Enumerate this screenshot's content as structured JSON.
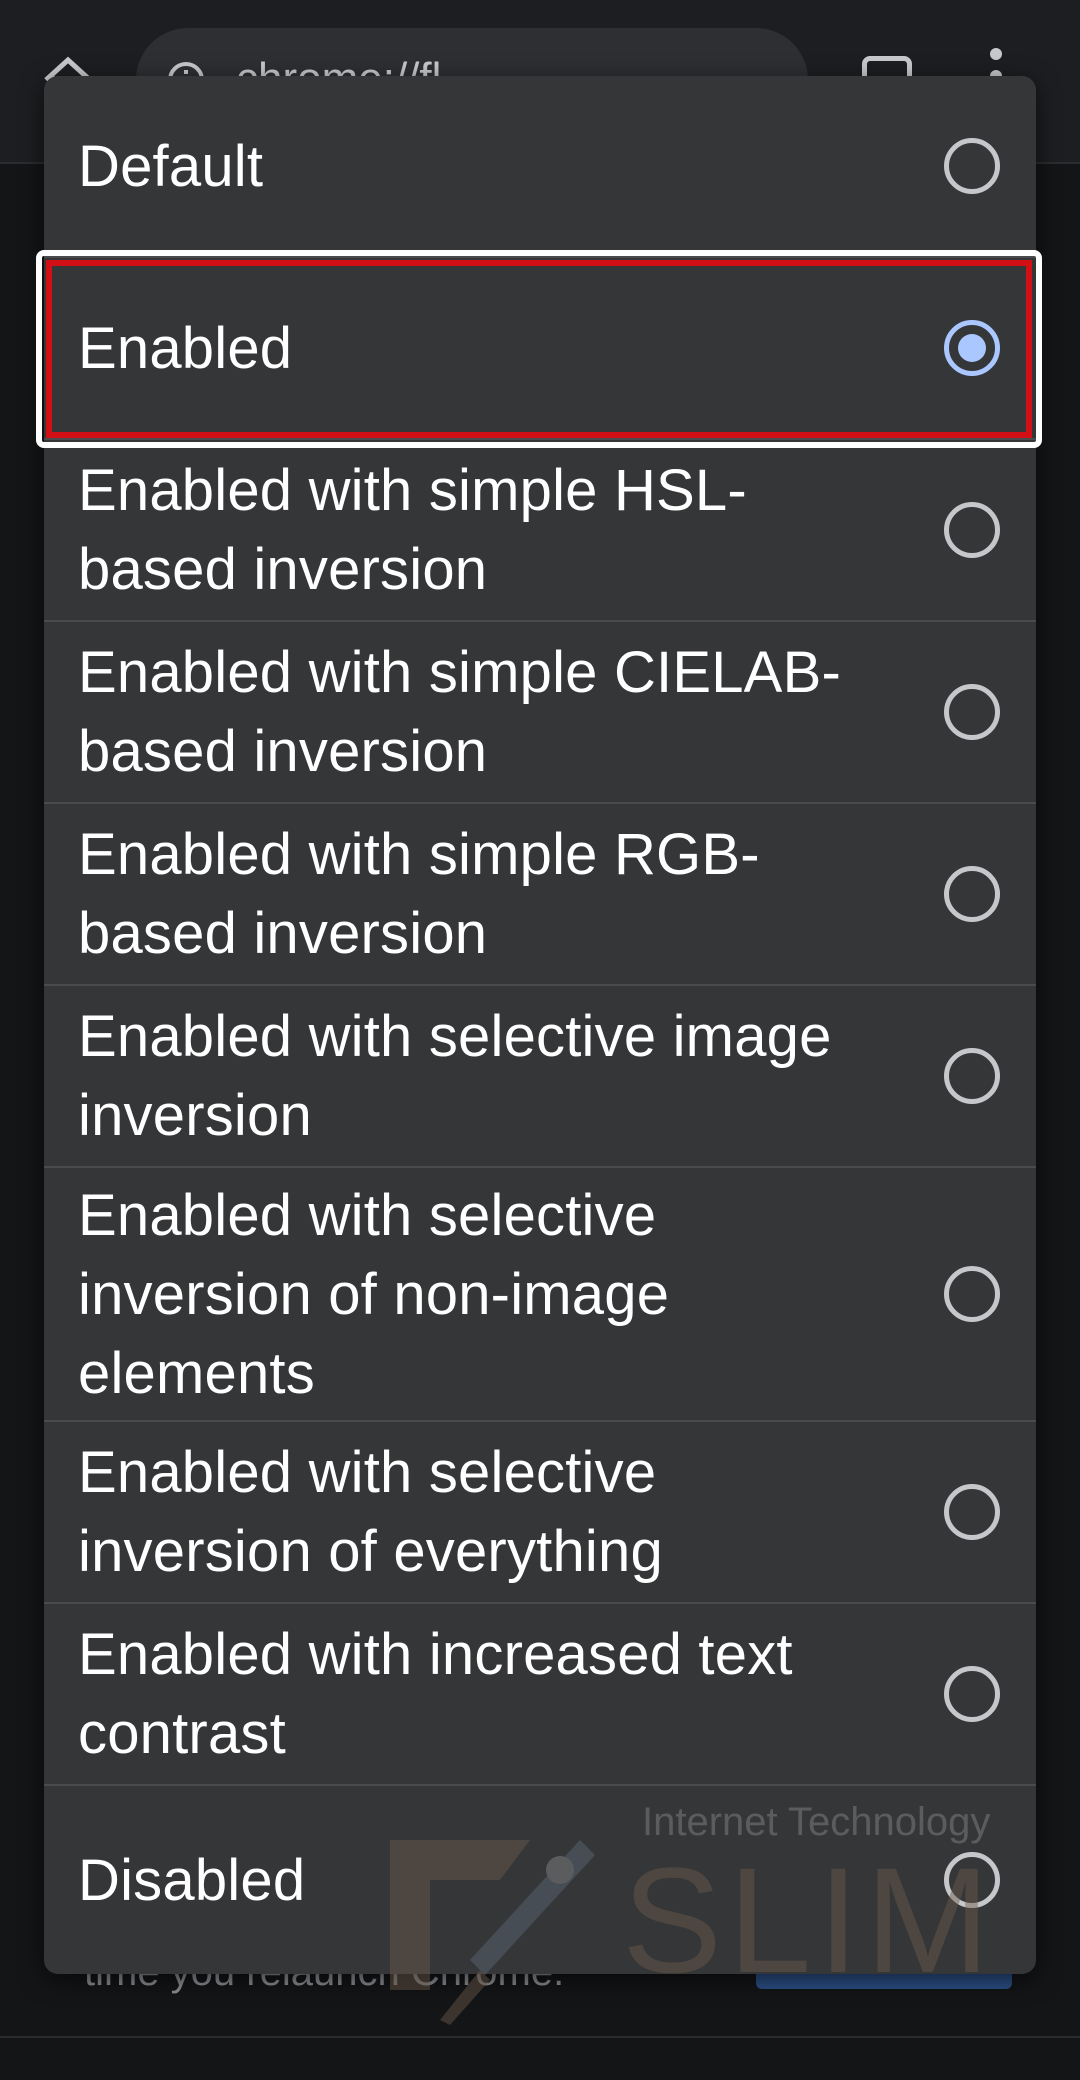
{
  "browser": {
    "url_partial": "chrome://fl"
  },
  "background": {
    "footer_text": "time you relaunch Chrome."
  },
  "dialog": {
    "selected_index": 1,
    "options": [
      {
        "label": "Default",
        "checked": false
      },
      {
        "label": "Enabled",
        "checked": true
      },
      {
        "label": "Enabled with simple HSL-based inversion",
        "checked": false
      },
      {
        "label": "Enabled with simple CIELAB-based inversion",
        "checked": false
      },
      {
        "label": "Enabled with simple RGB-based inversion",
        "checked": false
      },
      {
        "label": "Enabled with selective image inversion",
        "checked": false
      },
      {
        "label": "Enabled with selective inversion of non-image elements",
        "checked": false
      },
      {
        "label": "Enabled with selective inversion of everything",
        "checked": false
      },
      {
        "label": "Enabled with increased text contrast",
        "checked": false
      },
      {
        "label": "Disabled",
        "checked": false
      }
    ]
  },
  "watermark": {
    "tagline": "Internet Technology",
    "brand": "SLIM"
  },
  "colors": {
    "dialog_bg": "#353638",
    "radio_checked": "#aac7ff",
    "highlight_red": "#d10f14"
  }
}
